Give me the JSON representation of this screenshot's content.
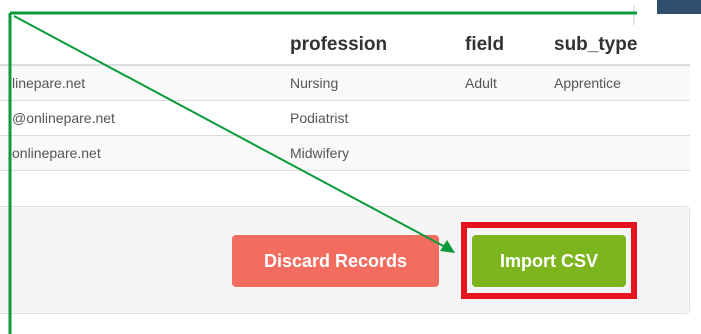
{
  "table": {
    "headers": [
      "",
      "profession",
      "field",
      "sub_type"
    ],
    "rows": [
      [
        "linepare.net",
        "Nursing",
        "Adult",
        "Apprentice"
      ],
      [
        "@onlinepare.net",
        "Podiatrist",
        "",
        ""
      ],
      [
        "onlinepare.net",
        "Midwifery",
        "",
        ""
      ]
    ]
  },
  "actions": {
    "discard_label": "Discard Records",
    "import_label": "Import CSV"
  },
  "colors": {
    "discard_button": "#f26d5f",
    "import_button": "#7cb51e",
    "highlight_box": "#e4151f",
    "annotation_arrow": "#0a9a3a"
  }
}
